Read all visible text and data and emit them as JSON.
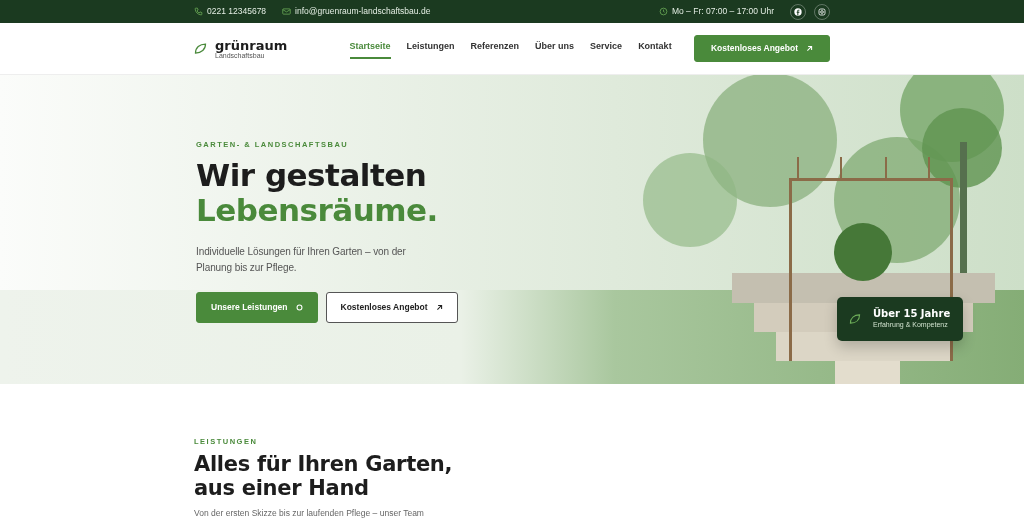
{
  "topbar": {
    "phone": "0221 12345678",
    "email": "info@gruenraum-landschaftsbau.de",
    "hours": "Mo – Fr: 07:00 – 17:00 Uhr"
  },
  "nav": {
    "logo": {
      "name": "grünraum",
      "tagline": "Landschaftsbau"
    },
    "links": [
      {
        "label": "Startseite",
        "selected": true
      },
      {
        "label": "Leistungen",
        "selected": false
      },
      {
        "label": "Referenzen",
        "selected": false
      },
      {
        "label": "Über uns",
        "selected": false
      },
      {
        "label": "Service",
        "selected": false
      },
      {
        "label": "Kontakt",
        "selected": false
      }
    ],
    "cta": "Kostenloses Angebot"
  },
  "hero": {
    "eyebrow": "GARTEN- & LANDSCHAFTSBAU",
    "title_line1": "Wir gestalten",
    "title_line2": "Lebensräume.",
    "lead": "Individuelle Lösungen für Ihren Garten – von der Planung bis zur Pflege.",
    "buttons": [
      {
        "label": "Unsere Leistungen",
        "kind": "primary"
      },
      {
        "label": "Kostenloses Angebot",
        "kind": "outline"
      }
    ],
    "badge": {
      "title": "Über 15 Jahre",
      "subtitle": "Erfahrung & Kompetenz"
    }
  },
  "services": {
    "eyebrow": "LEISTUNGEN",
    "title_line1": "Alles für Ihren Garten,",
    "title_line2": "aus einer Hand",
    "intro": "Von der ersten Skizze bis zur laufenden Pflege – unser Team"
  }
}
